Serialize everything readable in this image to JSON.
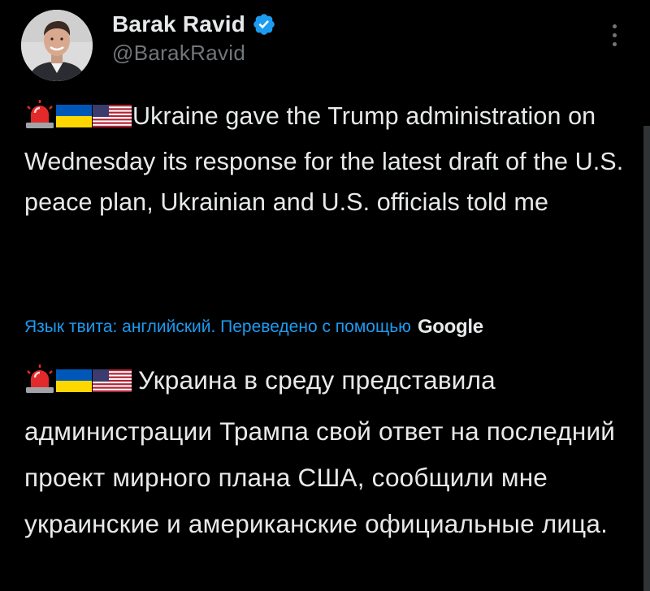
{
  "author": {
    "display_name": "Barak Ravid",
    "handle": "@BarakRavid",
    "verified": true,
    "avatar_icon": "avatar-photo"
  },
  "menu": {
    "icon": "more-vertical-icon"
  },
  "tweet": {
    "emojis": [
      "rotating-light-emoji",
      "ukraine-flag-emoji",
      "us-flag-emoji"
    ],
    "text": "Ukraine gave the Trump administration on Wednesday its response for the latest draft of the U.S. peace plan, Ukrainian and U.S. officials told me"
  },
  "translation": {
    "note": "Язык твита: английский. Переведено с помощью",
    "provider": "Google",
    "translated_text": "Украина в среду представила администрации Трампа свой ответ на последний проект мирного плана США, сообщили мне украинские и американские официальные лица."
  },
  "colors": {
    "background": "#000000",
    "text": "#e7e9ea",
    "secondary": "#71767b",
    "accent": "#1d9bf0"
  }
}
